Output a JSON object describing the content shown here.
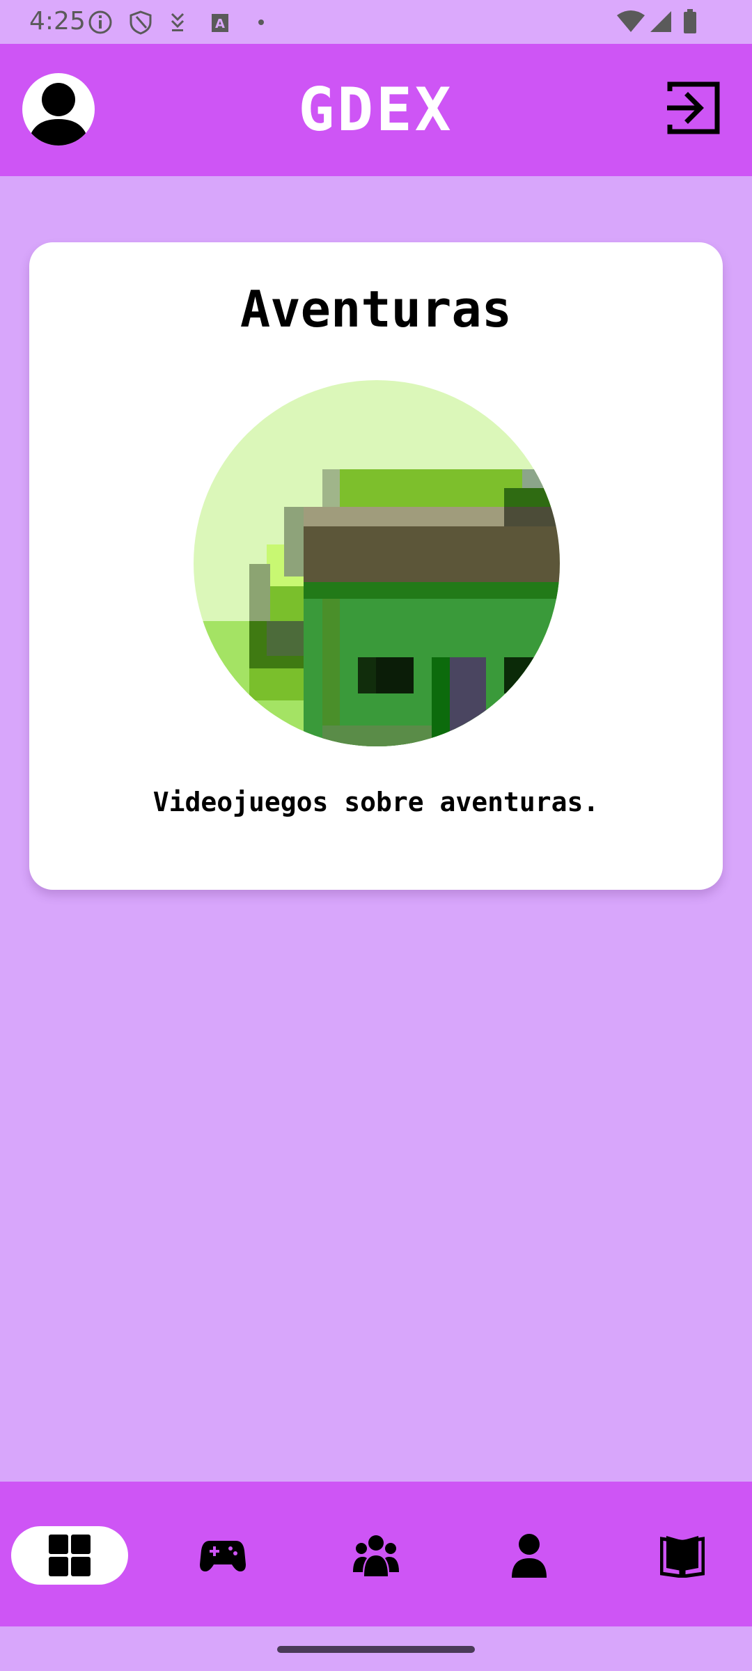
{
  "status_bar": {
    "time": "4:25"
  },
  "app_bar": {
    "title": "GDEX",
    "avatar_icon": "person-icon",
    "logout_icon": "logout-icon"
  },
  "category_card": {
    "title": "Aventuras",
    "description": "Videojuegos sobre aventuras."
  },
  "bottom_nav": {
    "items": [
      {
        "icon": "grid-icon",
        "active": true
      },
      {
        "icon": "gamepad-icon",
        "active": false
      },
      {
        "icon": "group-icon",
        "active": false
      },
      {
        "icon": "person-icon",
        "active": false
      },
      {
        "icon": "book-icon",
        "active": false
      }
    ]
  },
  "colors": {
    "background": "#d8a6fb",
    "app_bar": "#ce55f5",
    "card": "#ffffff",
    "active_nav_pill": "#ffffff"
  }
}
